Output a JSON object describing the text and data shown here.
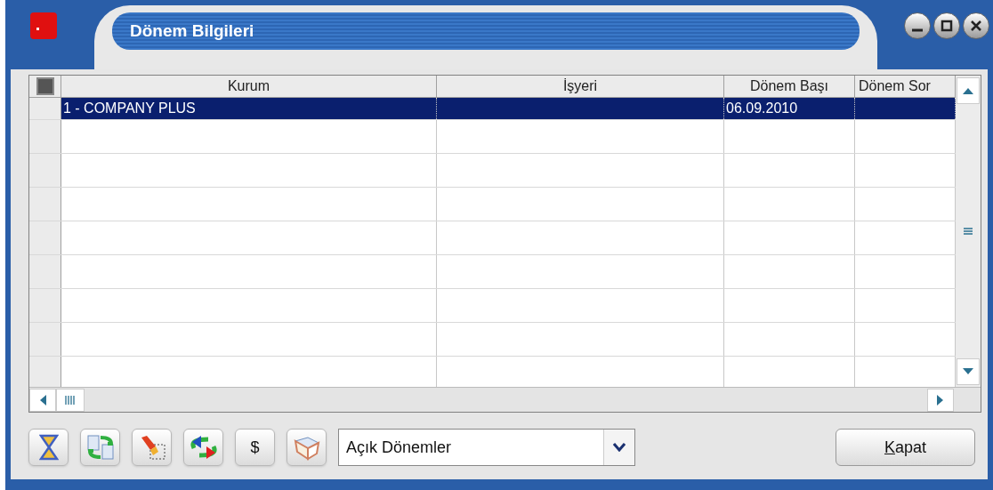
{
  "window": {
    "title": "Dönem Bilgileri"
  },
  "table": {
    "select_all": {
      "checked": true
    },
    "columns": [
      "Kurum",
      "İşyeri",
      "Dönem Başı",
      "Dönem Sor"
    ],
    "rows": [
      {
        "cells": [
          "1 - COMPANY PLUS",
          "",
          "06.09.2010",
          ""
        ],
        "selected": true
      }
    ]
  },
  "toolbar": {
    "currency_button": "$",
    "filter": {
      "value": "Açık Dönemler"
    },
    "close_button": "Kapat"
  }
}
